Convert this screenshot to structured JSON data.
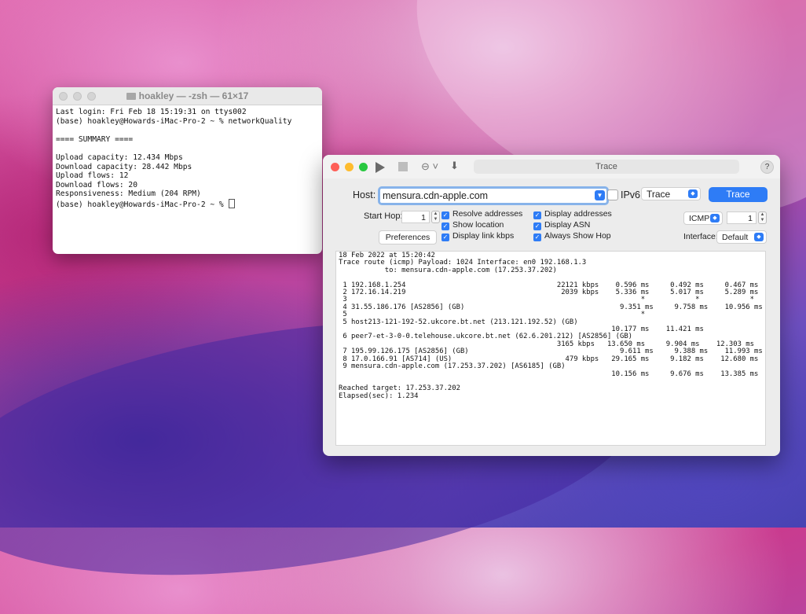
{
  "terminal": {
    "title": "hoakley — -zsh — 61×17",
    "lines": [
      "Last login: Fri Feb 18 15:19:31 on ttys002",
      "(base) hoakley@Howards-iMac-Pro-2 ~ % networkQuality",
      "",
      "==== SUMMARY ====",
      "",
      "Upload capacity: 12.434 Mbps",
      "Download capacity: 28.442 Mbps",
      "Upload flows: 12",
      "Download flows: 20",
      "Responsiveness: Medium (204 RPM)",
      "(base) hoakley@Howards-iMac-Pro-2 ~ % "
    ]
  },
  "trace_window": {
    "title": "Trace",
    "help": "?",
    "host_label": "Host:",
    "host_value": "mensura.cdn-apple.com",
    "ipv6_label": "IPv6",
    "mode_select": "Trace",
    "trace_button": "Trace",
    "start_hop_label": "Start Hop:",
    "start_hop_value": "1",
    "checkboxes": {
      "resolve_addresses": "Resolve addresses",
      "show_location": "Show location",
      "display_link_kbps": "Display link kbps",
      "display_addresses": "Display addresses",
      "display_asn": "Display ASN",
      "always_show_hop": "Always Show Hop"
    },
    "protocol_select": "ICMP",
    "protocol_count": "1",
    "preferences_button": "Preferences",
    "interface_label": "Interface:",
    "interface_select": "Default",
    "output_lines": [
      "18 Feb 2022 at 15:20:42",
      "Trace route (icmp) Payload: 1024 Interface: en0 192.168.1.3",
      "           to: mensura.cdn-apple.com (17.253.37.202)",
      "",
      " 1 192.168.1.254                                    22121 kbps    0.596 ms     0.492 ms     0.467 ms",
      " 2 172.16.14.219                                     2039 kbps    5.336 ms     5.017 ms     5.289 ms",
      " 3                                                                      *            *            *",
      " 4 31.55.186.176 [AS2856] (GB)                                     9.351 ms     9.758 ms    10.956 ms",
      " 5                                                                      *",
      " 5 host213-121-192-52.ukcore.bt.net (213.121.192.52) (GB)",
      "                                                                 10.177 ms    11.421 ms",
      " 6 peer7-et-3-0-0.telehouse.ukcore.bt.net (62.6.201.212) [AS2856] (GB)",
      "                                                    3165 kbps   13.650 ms     9.904 ms    12.303 ms",
      " 7 195.99.126.175 [AS2856] (GB)                                    9.611 ms     9.388 ms    11.993 ms",
      " 8 17.0.166.91 [AS714] (US)                           479 kbps   29.165 ms     9.182 ms    12.680 ms",
      " 9 mensura.cdn-apple.com (17.253.37.202) [AS6185] (GB)",
      "                                                                 10.156 ms     9.676 ms    13.385 ms",
      "",
      "Reached target: 17.253.37.202",
      "Elapsed(sec): 1.234"
    ]
  }
}
